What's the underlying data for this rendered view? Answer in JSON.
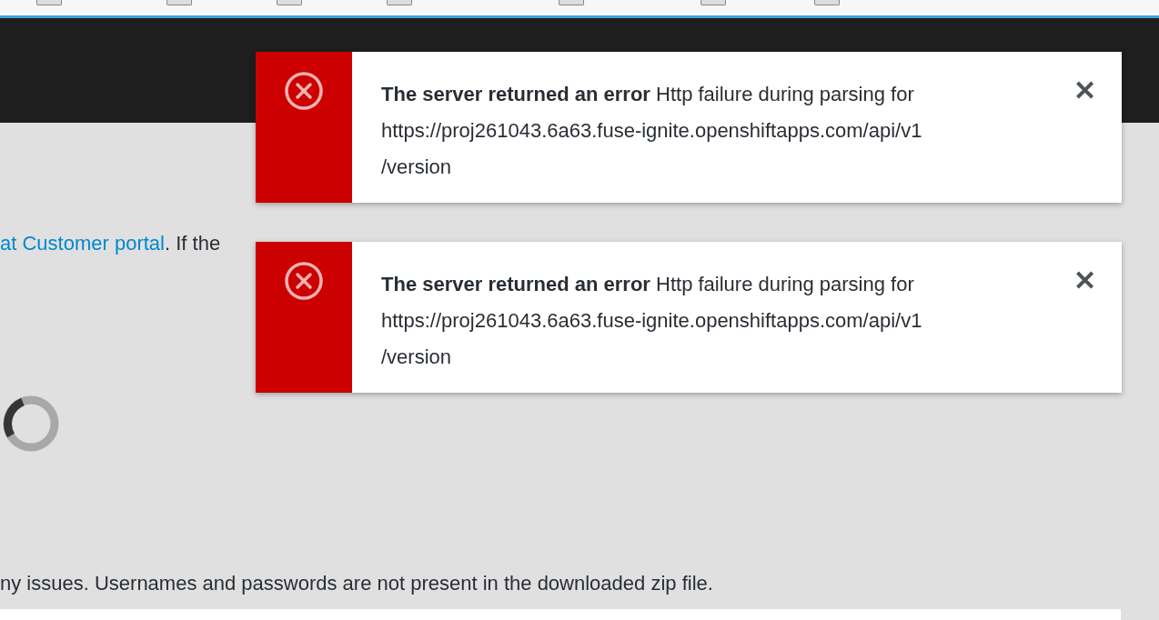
{
  "body": {
    "link": "at Customer portal",
    "text_after": ". If the",
    "footer_text": "ny issues. Usernames and passwords are not present in the downloaded zip file."
  },
  "toasts": [
    {
      "kind": "error",
      "title": "The server returned an error",
      "message": "Http failure during parsing for",
      "url_lines": [
        "https://proj261043.6a63.fuse-ignite.openshiftapps.com/api/v1",
        "/version"
      ],
      "close": "✕"
    },
    {
      "kind": "error",
      "title": "The server returned an error",
      "message": "Http failure during parsing for",
      "url_lines": [
        "https://proj261043.6a63.fuse-ignite.openshiftapps.com/api/v1",
        "/version"
      ],
      "close": "✕"
    }
  ]
}
